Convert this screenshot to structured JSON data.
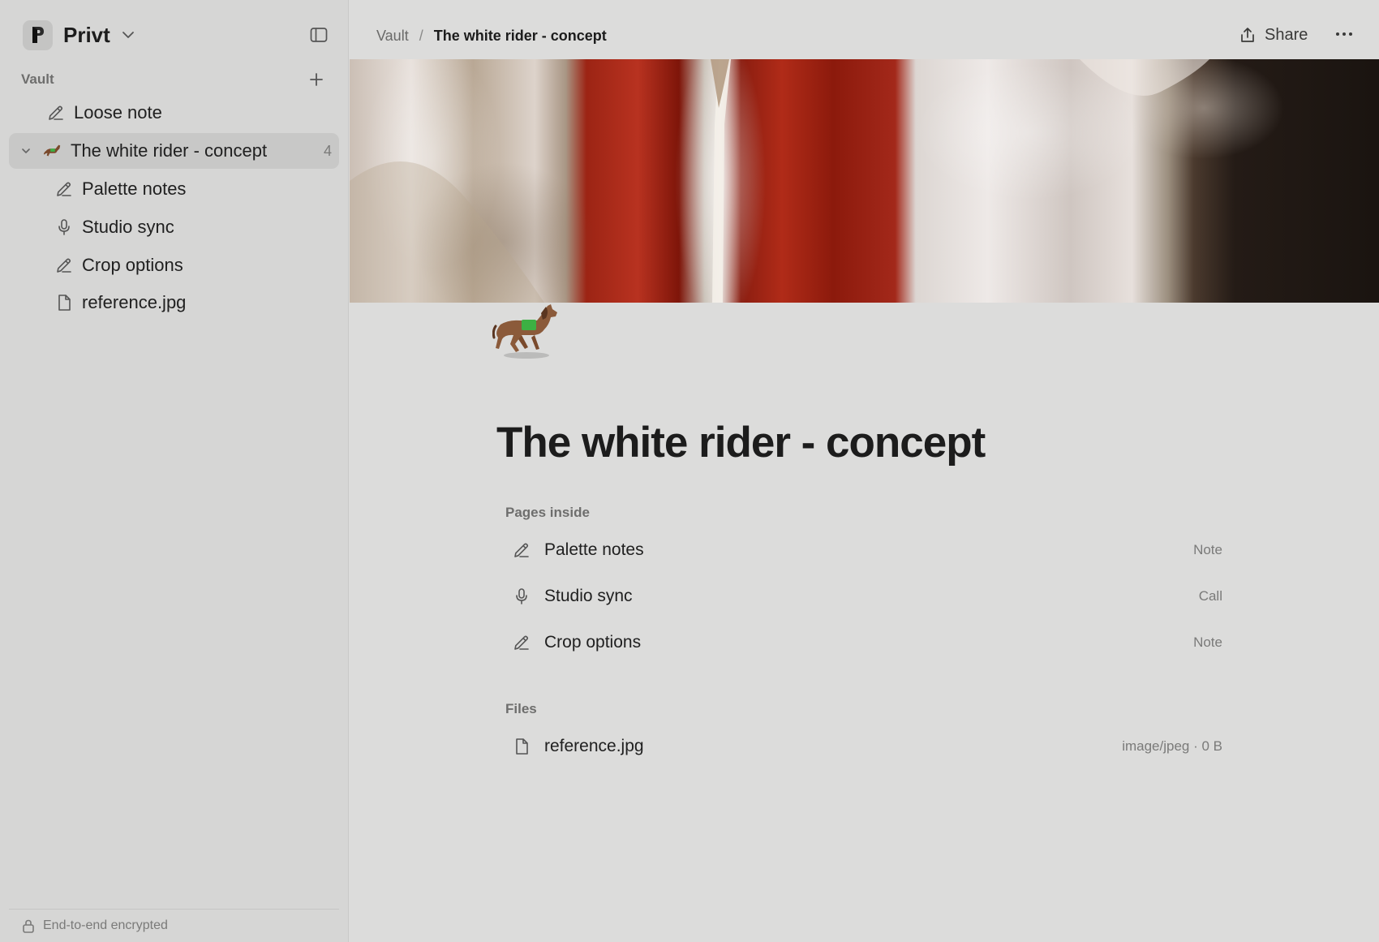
{
  "workspace": {
    "name": "Privt"
  },
  "sidebar": {
    "section_label": "Vault",
    "items": [
      {
        "label": "Loose note",
        "icon": "pencil-icon"
      },
      {
        "label": "The white rider - concept",
        "icon": "horse-icon",
        "count": "4",
        "active": true
      },
      {
        "label": "Palette notes",
        "icon": "pencil-icon"
      },
      {
        "label": "Studio sync",
        "icon": "microphone-icon"
      },
      {
        "label": "Crop options",
        "icon": "pencil-icon"
      },
      {
        "label": "reference.jpg",
        "icon": "file-icon"
      }
    ],
    "footer": "End-to-end encrypted"
  },
  "header": {
    "breadcrumb": {
      "parent": "Vault",
      "separator": "/",
      "current": "The white rider - concept"
    },
    "share_label": "Share"
  },
  "page": {
    "title": "The white rider - concept",
    "pages_label": "Pages inside",
    "pages": [
      {
        "label": "Palette notes",
        "type": "Note",
        "icon": "pencil-icon"
      },
      {
        "label": "Studio sync",
        "type": "Call",
        "icon": "microphone-icon"
      },
      {
        "label": "Crop options",
        "type": "Note",
        "icon": "pencil-icon"
      }
    ],
    "files_label": "Files",
    "files": [
      {
        "label": "reference.jpg",
        "meta": "image/jpeg · 0 B",
        "icon": "file-icon"
      }
    ]
  },
  "colors": {
    "sidebar_bg": "#d6d6d5",
    "main_bg": "#dcdcdb",
    "active_item_bg": "#c8c8c7",
    "cover_red": "#9c2414"
  }
}
